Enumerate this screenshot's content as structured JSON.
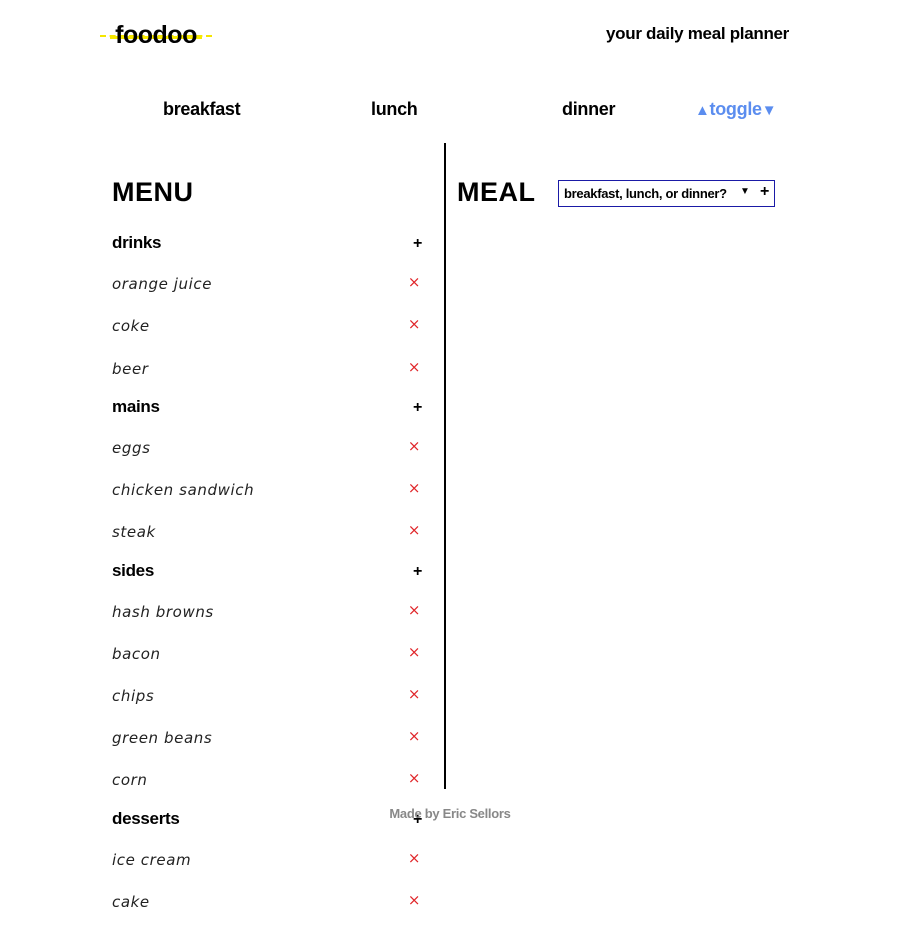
{
  "header": {
    "logo": "foodoo",
    "tagline": "your daily meal planner"
  },
  "nav": {
    "breakfast": "breakfast",
    "lunch": "lunch",
    "dinner": "dinner",
    "toggle_up": "▲",
    "toggle_label": "toggle",
    "toggle_down": "▼"
  },
  "menu": {
    "title": "MENU",
    "categories": [
      {
        "name": "drinks",
        "add": "+",
        "items": [
          "orange juice",
          "coke",
          "beer"
        ]
      },
      {
        "name": "mains",
        "add": "+",
        "items": [
          "eggs",
          "chicken sandwich",
          "steak"
        ]
      },
      {
        "name": "sides",
        "add": "+",
        "items": [
          "hash browns",
          "bacon",
          "chips",
          "green beans",
          "corn"
        ]
      },
      {
        "name": "desserts",
        "add": "+",
        "items": [
          "ice cream",
          "cake"
        ]
      }
    ],
    "remove_symbol": "×"
  },
  "meal": {
    "title": "MEAL",
    "select_value": "breakfast, lunch, or dinner?",
    "select_caret": "▼",
    "add": "+"
  },
  "footer": {
    "credit": "Made by Eric Sellors"
  },
  "colors": {
    "logo_highlight": "#f8ea00",
    "toggle": "#5b8def",
    "remove": "#e0262a",
    "select_border": "#1a1aa6",
    "footer": "#888888"
  }
}
